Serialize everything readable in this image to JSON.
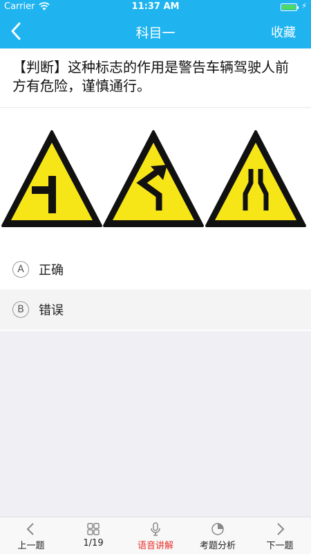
{
  "status_bar": {
    "carrier": "Carrier",
    "time": "11:37 AM"
  },
  "nav": {
    "title": "科目一",
    "favorite_label": "收藏"
  },
  "question": {
    "text": "【判断】这种标志的作用是警告车辆驾驶人前方有危险，谨慎通行。"
  },
  "options": [
    {
      "letter": "A",
      "text": "正确"
    },
    {
      "letter": "B",
      "text": "错误"
    }
  ],
  "toolbar": {
    "prev": "上一题",
    "progress": "1/19",
    "voice": "语音讲解",
    "analysis": "考题分析",
    "next": "下一题"
  },
  "colors": {
    "primary": "#1fb4f0",
    "active": "#e8322c",
    "sign_yellow": "#f7e617"
  },
  "icons": [
    "wifi-icon",
    "battery-icon",
    "back-chevron-icon",
    "grid-icon",
    "microphone-icon",
    "pie-chart-icon",
    "chevron-left-icon",
    "chevron-right-icon"
  ]
}
